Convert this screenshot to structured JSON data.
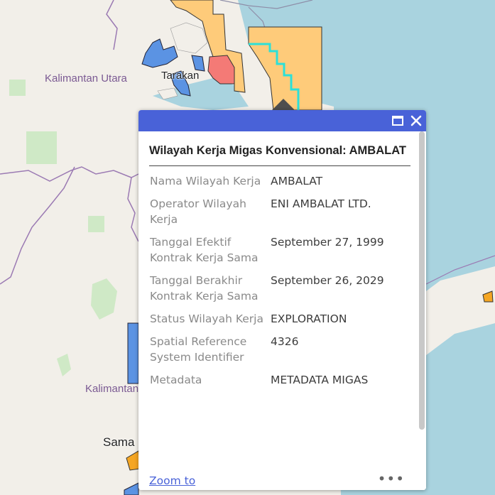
{
  "map": {
    "labels": {
      "kaltara": "Kalimantan Utara",
      "tarakan": "Tarakan",
      "kaltim": "Kalimantan",
      "samarinda": "Sama"
    }
  },
  "popup": {
    "title": "Wilayah Kerja Migas Konvensional: AMBALAT",
    "fields": [
      {
        "key": "Nama Wilayah Kerja",
        "value": "AMBALAT"
      },
      {
        "key": "Operator Wilayah Kerja",
        "value": "ENI AMBALAT LTD."
      },
      {
        "key": "Tanggal Efektif Kontrak Kerja Sama",
        "value": "September 27, 1999"
      },
      {
        "key": "Tanggal Berakhir Kontrak Kerja Sama",
        "value": "September 26, 2029"
      },
      {
        "key": "Status Wilayah Kerja",
        "value": "EXPLORATION"
      },
      {
        "key": "Spatial Reference System Identifier",
        "value": "4326"
      },
      {
        "key": "Metadata",
        "value": "METADATA MIGAS"
      }
    ],
    "zoom_label": "Zoom to",
    "more_label": "•••"
  },
  "colors": {
    "header": "#4962d8",
    "sea": "#a9d3df",
    "land": "#f2efe9",
    "block_orange": "#fecb7a",
    "block_blue": "#5b93e3",
    "block_red": "#f47a76",
    "border_purple": "#9b7ab3"
  }
}
